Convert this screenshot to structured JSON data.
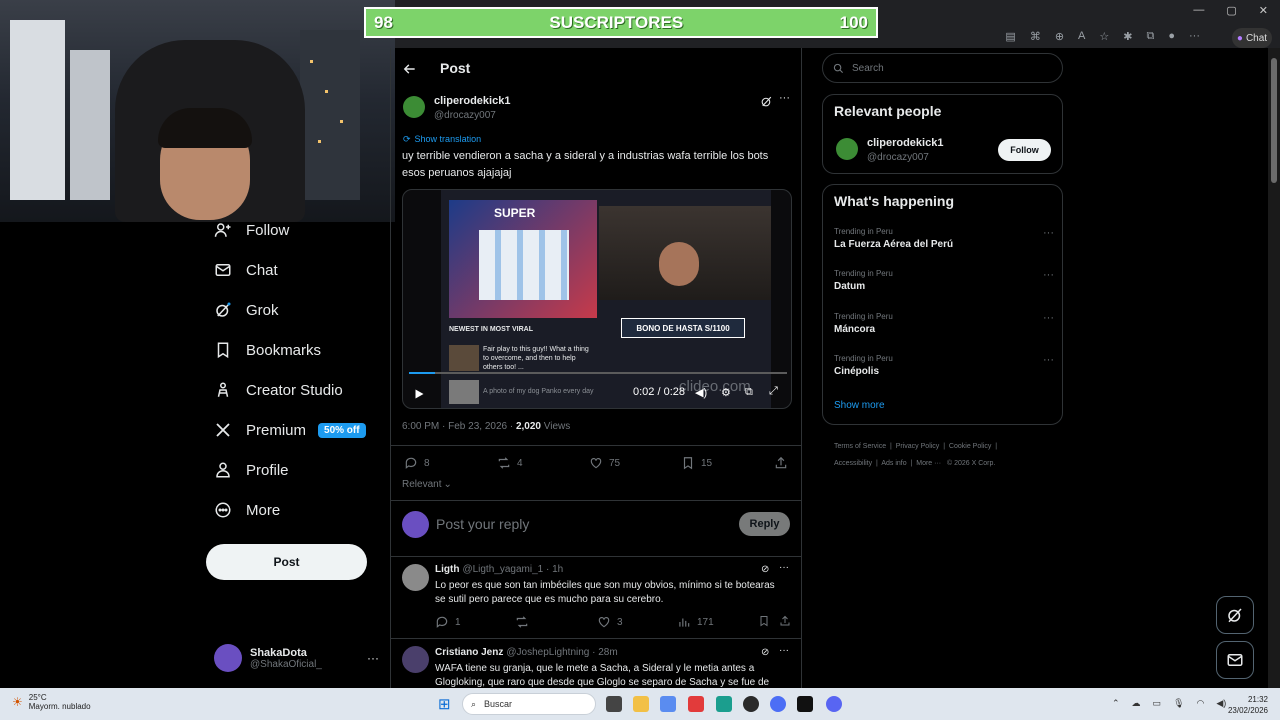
{
  "stream_overlay": {
    "goal_left": "98",
    "goal_label": "SUSCRIPTORES",
    "goal_right": "100"
  },
  "browser": {
    "chat_label": "Chat"
  },
  "nav": {
    "items": [
      {
        "label": "Follow",
        "icon": "follow-icon"
      },
      {
        "label": "Chat",
        "icon": "mail-icon"
      },
      {
        "label": "Grok",
        "icon": "grok-icon"
      },
      {
        "label": "Bookmarks",
        "icon": "bookmark-icon"
      },
      {
        "label": "Creator Studio",
        "icon": "creator-studio-icon"
      },
      {
        "label": "Premium",
        "icon": "x-icon"
      },
      {
        "label": "Profile",
        "icon": "person-icon"
      },
      {
        "label": "More",
        "icon": "more-circle-icon"
      }
    ],
    "premium_badge": "50% off",
    "post_button": "Post",
    "account": {
      "name": "ShakaDota",
      "handle": "@ShakaOficial_"
    }
  },
  "post": {
    "header_title": "Post",
    "author_name": "cliperodekick1",
    "author_handle": "@drocazy007",
    "show_translation": "Show translation",
    "text": "uy terrible vendieron a sacha y a sideral  y a industrias wafa terrible  los bots esos peruanos  ajajajaj",
    "video": {
      "ad_title": "SUPER",
      "bono_text": "BONO DE HASTA S/1100",
      "feed_label": "NEWEST IN MOST VIRAL",
      "feed_text": "Fair play to this guy!! What a thing to overcome, and then to help others too! ...",
      "feed_text2": "A photo of my dog Panko every day",
      "watermark": "clideo.com",
      "time": "0:02 / 0:28",
      "progress": 0.07
    },
    "timestamp": "6:00 PM · Feb 23, 2026 · ",
    "views_count": "2,020",
    "views_label": " Views",
    "stats": {
      "replies": "8",
      "reposts": "4",
      "likes": "75",
      "bookmarks": "15"
    },
    "sort_label": "Relevant",
    "reply_placeholder": "Post your reply",
    "reply_button": "Reply"
  },
  "replies": [
    {
      "name": "Ligth",
      "handle": "@Ligth_yagami_1 · 1h",
      "text": "Lo peor es que son tan imbéciles que son muy obvios, mínimo si te botearas se sutil pero parece que es mucho para su cerebro.",
      "replies": "1",
      "likes": "3",
      "views": "171"
    },
    {
      "name": "Cristiano Jenz",
      "handle": "@JoshepLightning · 28m",
      "text": "WAFA tiene su granja, que le mete a Sacha, a Sideral y le metia antes a Glogloking, que raro que desde que Gloglo se separo de Sacha y se fue de"
    }
  ],
  "sidebar": {
    "search_placeholder": "Search",
    "relevant_title": "Relevant people",
    "relevant_person": {
      "name": "cliperodekick1",
      "handle": "@drocazy007"
    },
    "follow_button": "Follow",
    "happening_title": "What's happening",
    "trends": [
      {
        "context": "Trending in Peru",
        "name": "La Fuerza Aérea del Perú"
      },
      {
        "context": "Trending in Peru",
        "name": "Datum"
      },
      {
        "context": "Trending in Peru",
        "name": "Máncora"
      },
      {
        "context": "Trending in Peru",
        "name": "Cinépolis"
      }
    ],
    "show_more": "Show more",
    "footer": [
      "Terms of Service",
      "Privacy Policy",
      "Cookie Policy",
      "Accessibility",
      "Ads info",
      "More ···",
      "© 2026 X Corp."
    ]
  },
  "taskbar": {
    "weather_temp": "25°C",
    "weather_desc": "Mayorm. nublado",
    "search_label": "Buscar",
    "time": "21:32",
    "date": "23/02/2026"
  },
  "colors": {
    "accent": "#1d9bf0",
    "goal_bar": "#7dd36a",
    "background": "#000000"
  }
}
